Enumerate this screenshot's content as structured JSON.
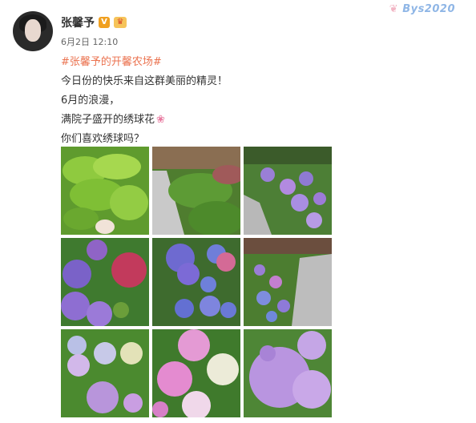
{
  "post": {
    "author": {
      "name": "张馨予",
      "verified_icon": "verified-badge-icon",
      "member_icon": "crown-icon"
    },
    "timestamp": "6月2日 12:10",
    "watermark": "Bys2020",
    "text": {
      "topic": "#张馨予的开馨农场#",
      "lines": [
        "今日份的快乐来自这群美丽的精灵！",
        "6月的浪漫，",
        "满院子盛开的绣球花",
        "你们喜欢绣球吗？"
      ],
      "emoji": "flower-emoji-icon"
    },
    "images": [
      {
        "name": "photo-green-leaves"
      },
      {
        "name": "photo-garden-path-shrubs"
      },
      {
        "name": "photo-hydrangea-bed-purple"
      },
      {
        "name": "photo-hydrangea-purple-red"
      },
      {
        "name": "photo-hydrangea-blue-pink"
      },
      {
        "name": "photo-hydrangea-garden-path"
      },
      {
        "name": "photo-hydrangea-white-purple"
      },
      {
        "name": "photo-hydrangea-pink-white"
      },
      {
        "name": "photo-hydrangea-lavender-closeup"
      }
    ],
    "colors": {
      "topic": "#eb7350",
      "verified": "#f0a020"
    }
  }
}
